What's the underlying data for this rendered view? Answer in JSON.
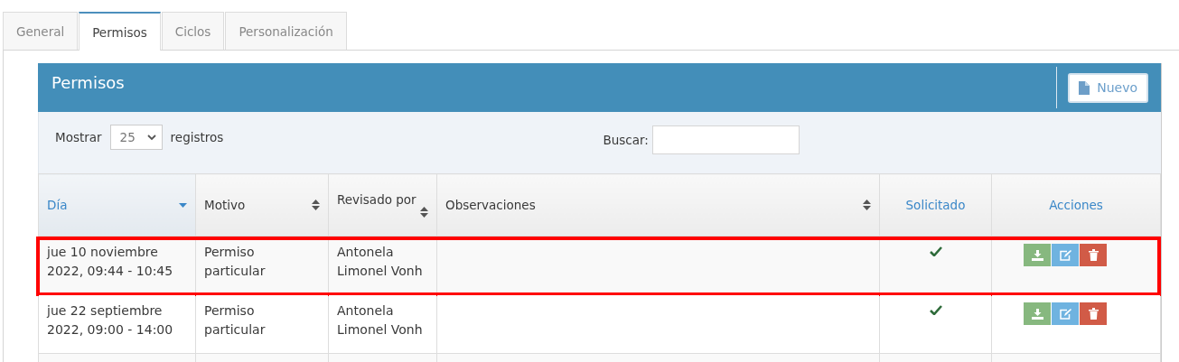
{
  "tabs": [
    {
      "label": "General",
      "selected": false
    },
    {
      "label": "Permisos",
      "selected": true
    },
    {
      "label": "Ciclos",
      "selected": false
    },
    {
      "label": "Personalización",
      "selected": false
    }
  ],
  "panel": {
    "title": "Permisos",
    "new_button": "Nuevo"
  },
  "length_control": {
    "before": "Mostrar",
    "value": "25",
    "after": "registros"
  },
  "search": {
    "label": "Buscar:"
  },
  "table": {
    "columns": [
      {
        "label": "Día",
        "kind": "sorted"
      },
      {
        "label": "Motivo",
        "kind": "sortable"
      },
      {
        "label": "Revisado por",
        "kind": "sortable"
      },
      {
        "label": "Observaciones",
        "kind": "sortable"
      },
      {
        "label": "Solicitado",
        "kind": "plain"
      },
      {
        "label": "Acciones",
        "kind": "plain"
      }
    ],
    "rows": [
      {
        "day": "jue 10 noviembre 2022, 09:44 - 10:45",
        "reason": "Permiso particular",
        "reviewed_by": "Antonela Limonel Vonh",
        "requested": true,
        "highlighted": true,
        "actions": [
          {
            "kind": "download"
          },
          {
            "kind": "edit"
          },
          {
            "kind": "delete"
          }
        ]
      },
      {
        "day": "jue 22 septiembre 2022, 09:00 - 14:00",
        "reason": "Permiso particular",
        "reviewed_by": "Antonela Limonel Vonh",
        "requested": true,
        "highlighted": false,
        "actions": [
          {
            "kind": "download"
          },
          {
            "kind": "edit"
          },
          {
            "kind": "delete"
          }
        ]
      }
    ]
  }
}
